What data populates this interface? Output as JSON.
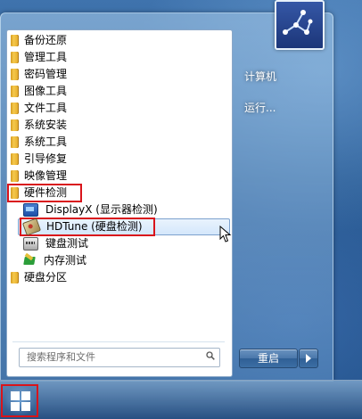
{
  "start_menu": {
    "programs": [
      {
        "label": "备份还原",
        "type": "folder"
      },
      {
        "label": "管理工具",
        "type": "folder"
      },
      {
        "label": "密码管理",
        "type": "folder"
      },
      {
        "label": "图像工具",
        "type": "folder"
      },
      {
        "label": "文件工具",
        "type": "folder"
      },
      {
        "label": "系统安装",
        "type": "folder"
      },
      {
        "label": "系统工具",
        "type": "folder"
      },
      {
        "label": "引导修复",
        "type": "folder"
      },
      {
        "label": "映像管理",
        "type": "folder"
      },
      {
        "label": "硬件检测",
        "type": "folder",
        "expanded": true,
        "highlighted": true
      },
      {
        "label": "DisplayX (显示器检测)",
        "type": "app",
        "icon": "monitor-icon"
      },
      {
        "label": "HDTune (硬盘检测)",
        "type": "app",
        "icon": "hard-disk-icon",
        "hovered": true,
        "highlighted": true
      },
      {
        "label": "键盘测试",
        "type": "app",
        "icon": "keyboard-icon"
      },
      {
        "label": "内存测试",
        "type": "app",
        "icon": "memory-icon"
      },
      {
        "label": "硬盘分区",
        "type": "folder"
      }
    ],
    "search": {
      "placeholder": "搜索程序和文件"
    },
    "right_pane": {
      "computer_label": "计算机",
      "run_label": "运行..."
    },
    "shutdown": {
      "label": "重启"
    }
  },
  "colors": {
    "highlight_border": "#d9141b",
    "hover_fill": "#d4e7fb"
  }
}
